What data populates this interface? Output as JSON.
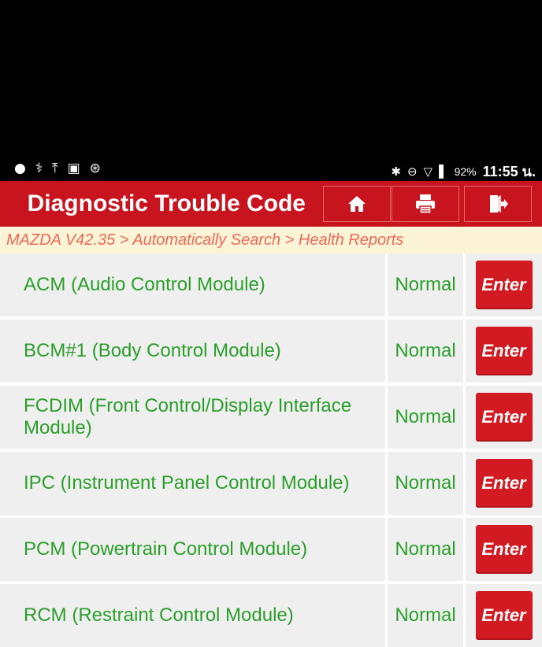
{
  "status_bar": {
    "left_icons": [
      "chat-icon",
      "stethoscope-icon",
      "upload-icon",
      "image-icon",
      "bluetooth-circle-icon"
    ],
    "right_icons": [
      "bluetooth-icon",
      "do-not-disturb-icon",
      "wifi-icon",
      "battery-icon"
    ],
    "battery": "92%",
    "time": "11:55 น."
  },
  "header": {
    "title": "Diagnostic Trouble Code",
    "buttons": [
      "home-icon",
      "print-icon",
      "exit-icon"
    ]
  },
  "breadcrumb": "MAZDA V42.35 > Automatically Search > Health Reports",
  "modules": [
    {
      "name": "ACM (Audio Control Module)",
      "status": "Normal",
      "action": "Enter"
    },
    {
      "name": "BCM#1 (Body Control Module)",
      "status": "Normal",
      "action": "Enter"
    },
    {
      "name": "FCDIM (Front Control/Display Interface Module)",
      "status": "Normal",
      "action": "Enter"
    },
    {
      "name": "IPC (Instrument Panel Control Module)",
      "status": "Normal",
      "action": "Enter"
    },
    {
      "name": "PCM (Powertrain Control Module)",
      "status": "Normal",
      "action": "Enter"
    },
    {
      "name": "RCM (Restraint Control Module)",
      "status": "Normal",
      "action": "Enter"
    }
  ],
  "colors": {
    "header_red": "#c8141e",
    "button_red": "#d11a22",
    "text_green": "#2b9e2b",
    "breadcrumb_bg": "#fdf4d8",
    "breadcrumb_text": "#ec6a56",
    "row_bg": "#efefef"
  }
}
